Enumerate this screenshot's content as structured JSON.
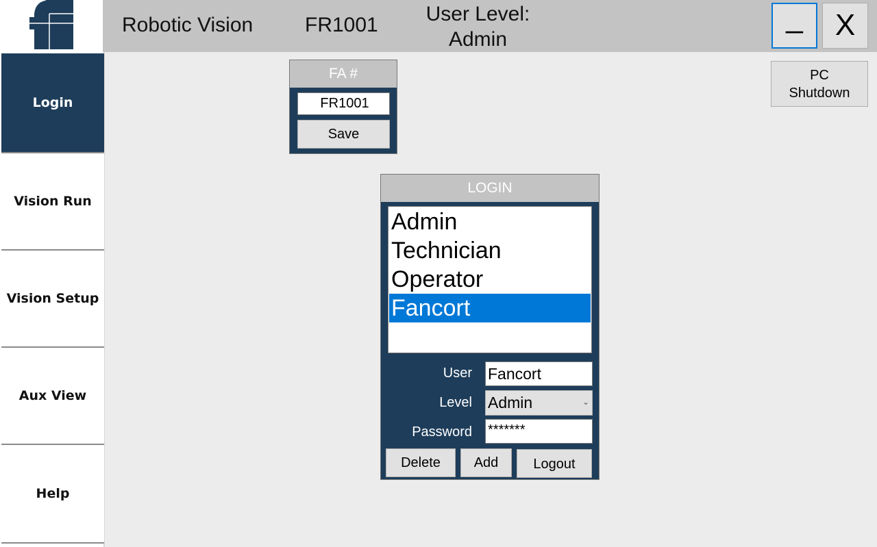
{
  "header": {
    "app_title": "Robotic Vision",
    "fa_number": "FR1001",
    "user_level_label": "User Level:",
    "user_level_value": "Admin",
    "minimize_label": "_",
    "close_label": "X"
  },
  "sidebar": {
    "items": [
      {
        "label": "Login",
        "active": true
      },
      {
        "label": "Vision Run"
      },
      {
        "label": "Vision Setup"
      },
      {
        "label": "Aux View"
      },
      {
        "label": "Help"
      }
    ]
  },
  "fa_panel": {
    "title": "FA #",
    "value": "FR1001",
    "save_label": "Save"
  },
  "shutdown_label": "PC Shutdown",
  "login_panel": {
    "title": "LOGIN",
    "users": [
      "Admin",
      "Technician",
      "Operator",
      "Fancort"
    ],
    "selected": "Fancort",
    "user_label": "User",
    "user_value": "Fancort",
    "level_label": "Level",
    "level_value": "Admin",
    "password_label": "Password",
    "password_value": "*******",
    "delete_label": "Delete",
    "add_label": "Add",
    "logout_label": "Logout"
  },
  "colors": {
    "brand": "#1e3d5a",
    "selection": "#0078d7",
    "header": "#c3c3c3"
  }
}
